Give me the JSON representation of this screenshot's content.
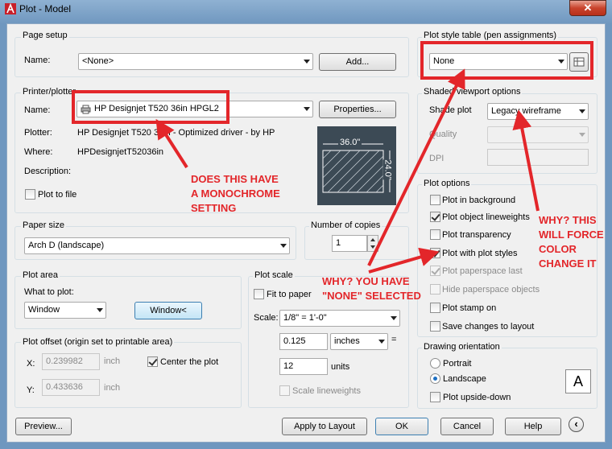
{
  "window": {
    "title": "Plot - Model",
    "close_glyph": "✕"
  },
  "page_setup": {
    "group": "Page setup",
    "name_label": "Name:",
    "name_value": "<None>",
    "add_button": "Add..."
  },
  "printer": {
    "group": "Printer/plotter",
    "name_label": "Name:",
    "name_value": "HP Designjet T520 36in  HPGL2",
    "properties_button": "Properties...",
    "plotter_label": "Plotter:",
    "plotter_value": "HP Designjet T520 36in - Optimized driver - by HP",
    "where_label": "Where:",
    "where_value": "HPDesignjetT52036in",
    "description_label": "Description:",
    "plot_to_file": "Plot to file",
    "preview_width": "36.0\"",
    "preview_height": "24.0\""
  },
  "paper_size": {
    "group": "Paper size",
    "value": "Arch D (landscape)"
  },
  "copies": {
    "group": "Number of copies",
    "value": "1"
  },
  "plot_area": {
    "group": "Plot area",
    "what_label": "What to plot:",
    "value": "Window",
    "window_button": "Window<"
  },
  "plot_offset": {
    "group": "Plot offset (origin set to printable area)",
    "x_label": "X:",
    "x_value": "0.239982",
    "y_label": "Y:",
    "y_value": "0.433636",
    "unit": "inch",
    "center": "Center the plot"
  },
  "plot_scale": {
    "group": "Plot scale",
    "fit": "Fit to paper",
    "scale_label": "Scale:",
    "scale_value": "1/8\" = 1'-0\"",
    "value1": "0.125",
    "unit1": "inches",
    "equals": "=",
    "value2": "12",
    "unit2": "units",
    "lineweights": "Scale lineweights"
  },
  "plot_style": {
    "group": "Plot style table (pen assignments)",
    "value": "None"
  },
  "shaded": {
    "group": "Shaded viewport options",
    "shade_label": "Shade plot",
    "shade_value": "Legacy wireframe",
    "quality_label": "Quality",
    "dpi_label": "DPI"
  },
  "plot_options": {
    "group": "Plot options",
    "items": [
      {
        "label": "Plot in background",
        "checked": false,
        "disabled": false
      },
      {
        "label": "Plot object lineweights",
        "checked": true,
        "disabled": false
      },
      {
        "label": "Plot transparency",
        "checked": false,
        "disabled": false
      },
      {
        "label": "Plot with plot styles",
        "checked": true,
        "disabled": false
      },
      {
        "label": "Plot paperspace last",
        "checked": true,
        "disabled": true
      },
      {
        "label": "Hide paperspace objects",
        "checked": false,
        "disabled": true
      },
      {
        "label": "Plot stamp on",
        "checked": false,
        "disabled": false
      },
      {
        "label": "Save changes to layout",
        "checked": false,
        "disabled": false
      }
    ]
  },
  "orientation": {
    "group": "Drawing orientation",
    "portrait": "Portrait",
    "landscape": "Landscape",
    "upside_down": "Plot upside-down",
    "icon_letter": "A"
  },
  "footer": {
    "preview": "Preview...",
    "apply": "Apply to Layout",
    "ok": "OK",
    "cancel": "Cancel",
    "help": "Help"
  },
  "annotations": {
    "monochrome": [
      "DOES THIS HAVE",
      "A MONOCHROME",
      "SETTING"
    ],
    "none": [
      "WHY? YOU HAVE",
      "\"NONE\" SELECTED"
    ],
    "color": [
      "WHY? THIS",
      "WILL FORCE",
      "COLOR",
      "CHANGE IT"
    ],
    "color_hex": "#e3262a"
  }
}
